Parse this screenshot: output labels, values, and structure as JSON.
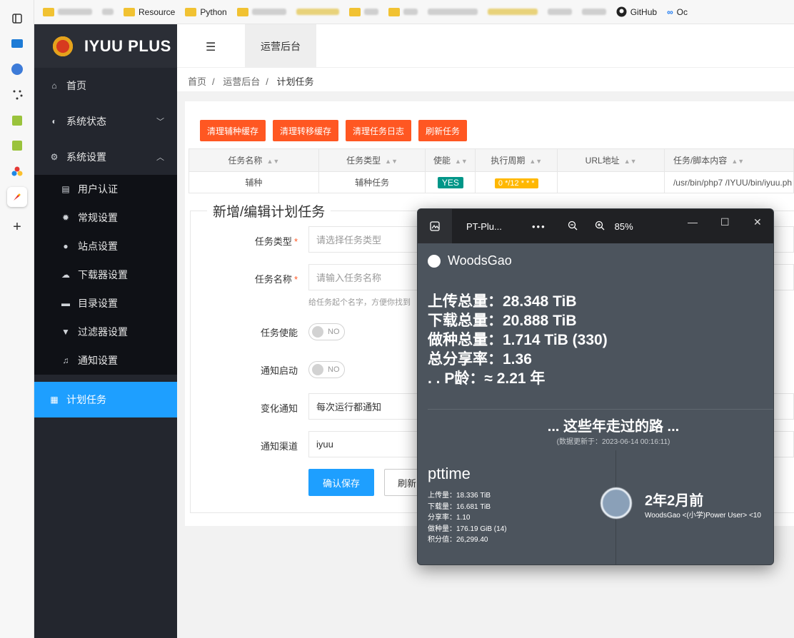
{
  "bookmarks": {
    "items": [
      "Resource",
      "Python",
      "GitHub",
      "Oc"
    ]
  },
  "sidebar": {
    "logo_text": "IYUU PLUS",
    "items": [
      {
        "label": "首页",
        "icon": "home-icon"
      },
      {
        "label": "系统状态",
        "icon": "dashboard-icon"
      },
      {
        "label": "系统设置",
        "icon": "gears-icon"
      }
    ],
    "submenu": [
      {
        "label": "用户认证",
        "icon": "id-card-icon"
      },
      {
        "label": "常规设置",
        "icon": "gear-icon"
      },
      {
        "label": "站点设置",
        "icon": "globe-icon"
      },
      {
        "label": "下载器设置",
        "icon": "cloud-download-icon"
      },
      {
        "label": "目录设置",
        "icon": "folder-icon"
      },
      {
        "label": "过滤器设置",
        "icon": "filter-icon"
      },
      {
        "label": "通知设置",
        "icon": "bell-icon"
      }
    ],
    "active_item": {
      "label": "计划任务",
      "icon": "calendar-icon"
    }
  },
  "header": {
    "tab_label": "运营后台"
  },
  "breadcrumb": [
    "首页",
    "运营后台",
    "计划任务"
  ],
  "toolbar": {
    "buttons": [
      "清理辅种缓存",
      "清理转移缓存",
      "清理任务日志",
      "刷新任务"
    ]
  },
  "table": {
    "columns": [
      "任务名称",
      "任务类型",
      "使能",
      "执行周期",
      "URL地址",
      "任务/脚本内容"
    ],
    "rows": [
      {
        "name": "辅种",
        "type": "辅种任务",
        "enabled": "YES",
        "cron": "0 */12 * * *",
        "url": "",
        "content": "/usr/bin/php7 /IYUU/bin/iyuu.ph"
      }
    ]
  },
  "form": {
    "legend": "新增/编辑计划任务",
    "task_type_label": "任务类型",
    "task_type_placeholder": "请选择任务类型",
    "task_name_label": "任务名称",
    "task_name_placeholder": "请输入任务名称",
    "task_name_hint": "给任务起个名字，方便你找到",
    "task_enable_label": "任务使能",
    "task_enable_value": "NO",
    "notify_enable_label": "通知启动",
    "notify_enable_value": "NO",
    "change_notify_label": "变化通知",
    "change_notify_value": "每次运行都通知",
    "notify_channel_label": "通知渠道",
    "notify_channel_value": "iyuu",
    "submit_label": "确认保存",
    "reset_label": "刷新"
  },
  "viewer": {
    "title": "PT-Plu...",
    "zoom": "85%",
    "username": "WoodsGao",
    "stats": [
      "上传总量：28.348 TiB",
      "下载总量：20.888 TiB",
      "做种总量：1.714 TiB (330)",
      "总分享率：1.36",
      ".  .  P龄：≈ 2.21 年"
    ],
    "journey_title": "... 这些年走过的路 ...",
    "updated": "(数据更新于：2023-06-14 00:16:11)",
    "site": {
      "name": "pttime",
      "lines": [
        "上传量：18.336 TiB",
        "下载量：16.681 TiB",
        "分享率：1.10",
        "做种量：176.19 GiB (14)",
        "积分值：26,299.40"
      ],
      "age": "2年2月前",
      "rank": "WoodsGao <(小学)Power User> <10"
    }
  }
}
